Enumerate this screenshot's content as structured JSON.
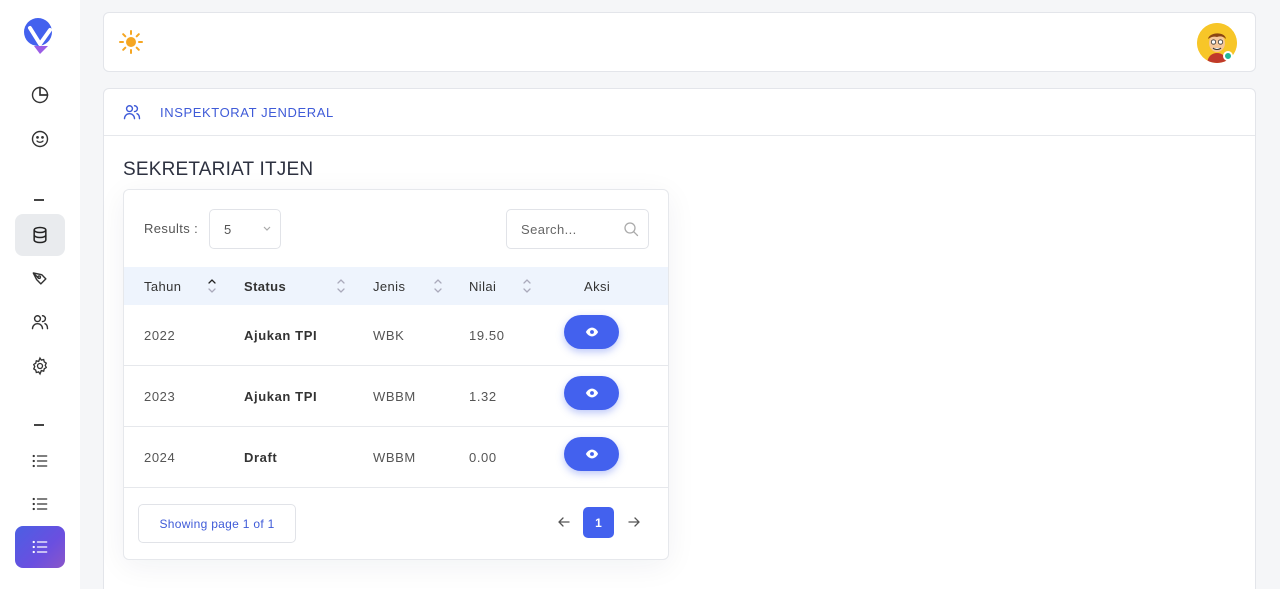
{
  "colors": {
    "accent": "#4361ee",
    "header_text": "#3f5bd8",
    "table_header_bg": "#eef4fd"
  },
  "sidebar": {
    "items": [
      {
        "name": "dashboard",
        "icon": "pie-chart-icon"
      },
      {
        "name": "smiley",
        "icon": "smile-icon"
      },
      {
        "name": "database",
        "icon": "database-icon",
        "state": "highlighted"
      },
      {
        "name": "pen",
        "icon": "pen-tool-icon"
      },
      {
        "name": "users",
        "icon": "users-icon"
      },
      {
        "name": "settings",
        "icon": "gear-icon"
      },
      {
        "name": "list-1",
        "icon": "list-icon"
      },
      {
        "name": "list-2",
        "icon": "list-icon"
      },
      {
        "name": "list-3",
        "icon": "list-icon",
        "state": "active"
      }
    ]
  },
  "topbar": {
    "theme_icon": "sun-icon",
    "avatar_icon": "avatar-icon"
  },
  "main": {
    "header_title": "INSPEKTORAT JENDERAL",
    "section_title": "SEKRETARIAT ITJEN",
    "table": {
      "results_label": "Results :",
      "results_value": "5",
      "search_placeholder": "Search...",
      "columns": [
        "Tahun",
        "Status",
        "Jenis",
        "Nilai",
        "Aksi"
      ],
      "rows": [
        {
          "tahun": "2022",
          "status": "Ajukan TPI",
          "jenis": "WBK",
          "nilai": "19.50"
        },
        {
          "tahun": "2023",
          "status": "Ajukan TPI",
          "jenis": "WBBM",
          "nilai": "1.32"
        },
        {
          "tahun": "2024",
          "status": "Draft",
          "jenis": "WBBM",
          "nilai": "0.00"
        }
      ],
      "page_info": "Showing page 1 of 1",
      "current_page": "1"
    }
  }
}
